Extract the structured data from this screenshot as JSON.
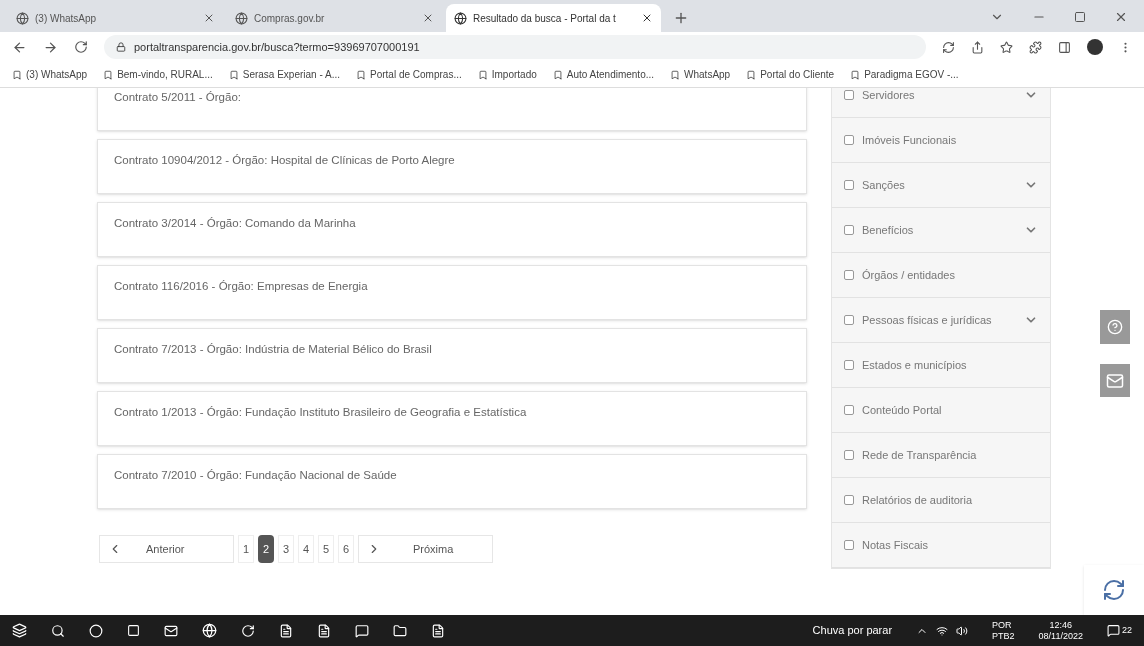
{
  "browser": {
    "tabs": [
      {
        "title": "(3) WhatsApp",
        "selected": false
      },
      {
        "title": "Compras.gov.br",
        "selected": false
      },
      {
        "title": "Resultado da busca - Portal da t",
        "selected": true
      }
    ],
    "address": "portaltransparencia.gov.br/busca?termo=93969707000191",
    "bookmarks": [
      "(3) WhatsApp",
      "Bem-vindo, RURAL...",
      "Serasa Experian - A...",
      "Portal de Compras...",
      "Importado",
      "Auto Atendimento...",
      "WhatsApp",
      "Portal do Cliente",
      "Paradigma EGOV -..."
    ]
  },
  "results": [
    {
      "text": "Contrato 5/2011 - Órgão:"
    },
    {
      "text": "Contrato 10904/2012 - Órgão: Hospital de Clínicas de Porto Alegre"
    },
    {
      "text": "Contrato 3/2014 - Órgão: Comando da Marinha"
    },
    {
      "text": "Contrato 116/2016 - Órgão: Empresas de Energia"
    },
    {
      "text": "Contrato 7/2013 - Órgão: Indústria de Material Bélico do Brasil"
    },
    {
      "text": "Contrato 1/2013 - Órgão: Fundação Instituto Brasileiro de Geografia e Estatística"
    },
    {
      "text": "Contrato 7/2010 - Órgão: Fundação Nacional de Saúde"
    }
  ],
  "pagination": {
    "previous": "Anterior",
    "next": "Próxima",
    "pages": [
      {
        "label": "1",
        "selected": false
      },
      {
        "label": "2",
        "selected": true
      },
      {
        "label": "3",
        "selected": false
      },
      {
        "label": "4",
        "selected": false
      },
      {
        "label": "5",
        "selected": false
      },
      {
        "label": "6",
        "selected": false
      }
    ]
  },
  "filters": [
    {
      "label": "Servidores",
      "checked": false,
      "expandable": true
    },
    {
      "label": "Imóveis Funcionais",
      "checked": false,
      "expandable": false
    },
    {
      "label": "Sanções",
      "checked": false,
      "expandable": true
    },
    {
      "label": "Benefícios",
      "checked": false,
      "expandable": true
    },
    {
      "label": "Órgãos / entidades",
      "checked": false,
      "expandable": false
    },
    {
      "label": "Pessoas físicas e jurídicas",
      "checked": false,
      "expandable": true
    },
    {
      "label": "Estados e municípios",
      "checked": false,
      "expandable": false
    },
    {
      "label": "Conteúdo Portal",
      "checked": false,
      "expandable": false
    },
    {
      "label": "Rede de Transparência",
      "checked": false,
      "expandable": false
    },
    {
      "label": "Relatórios de auditoria",
      "checked": false,
      "expandable": false
    },
    {
      "label": "Notas Fiscais",
      "checked": false,
      "expandable": false
    }
  ],
  "taskbar": {
    "weather": "Chuva por parar",
    "language": "POR",
    "layout": "PTB2",
    "time": "12:46",
    "date": "08/11/2022",
    "notifications": "22"
  }
}
